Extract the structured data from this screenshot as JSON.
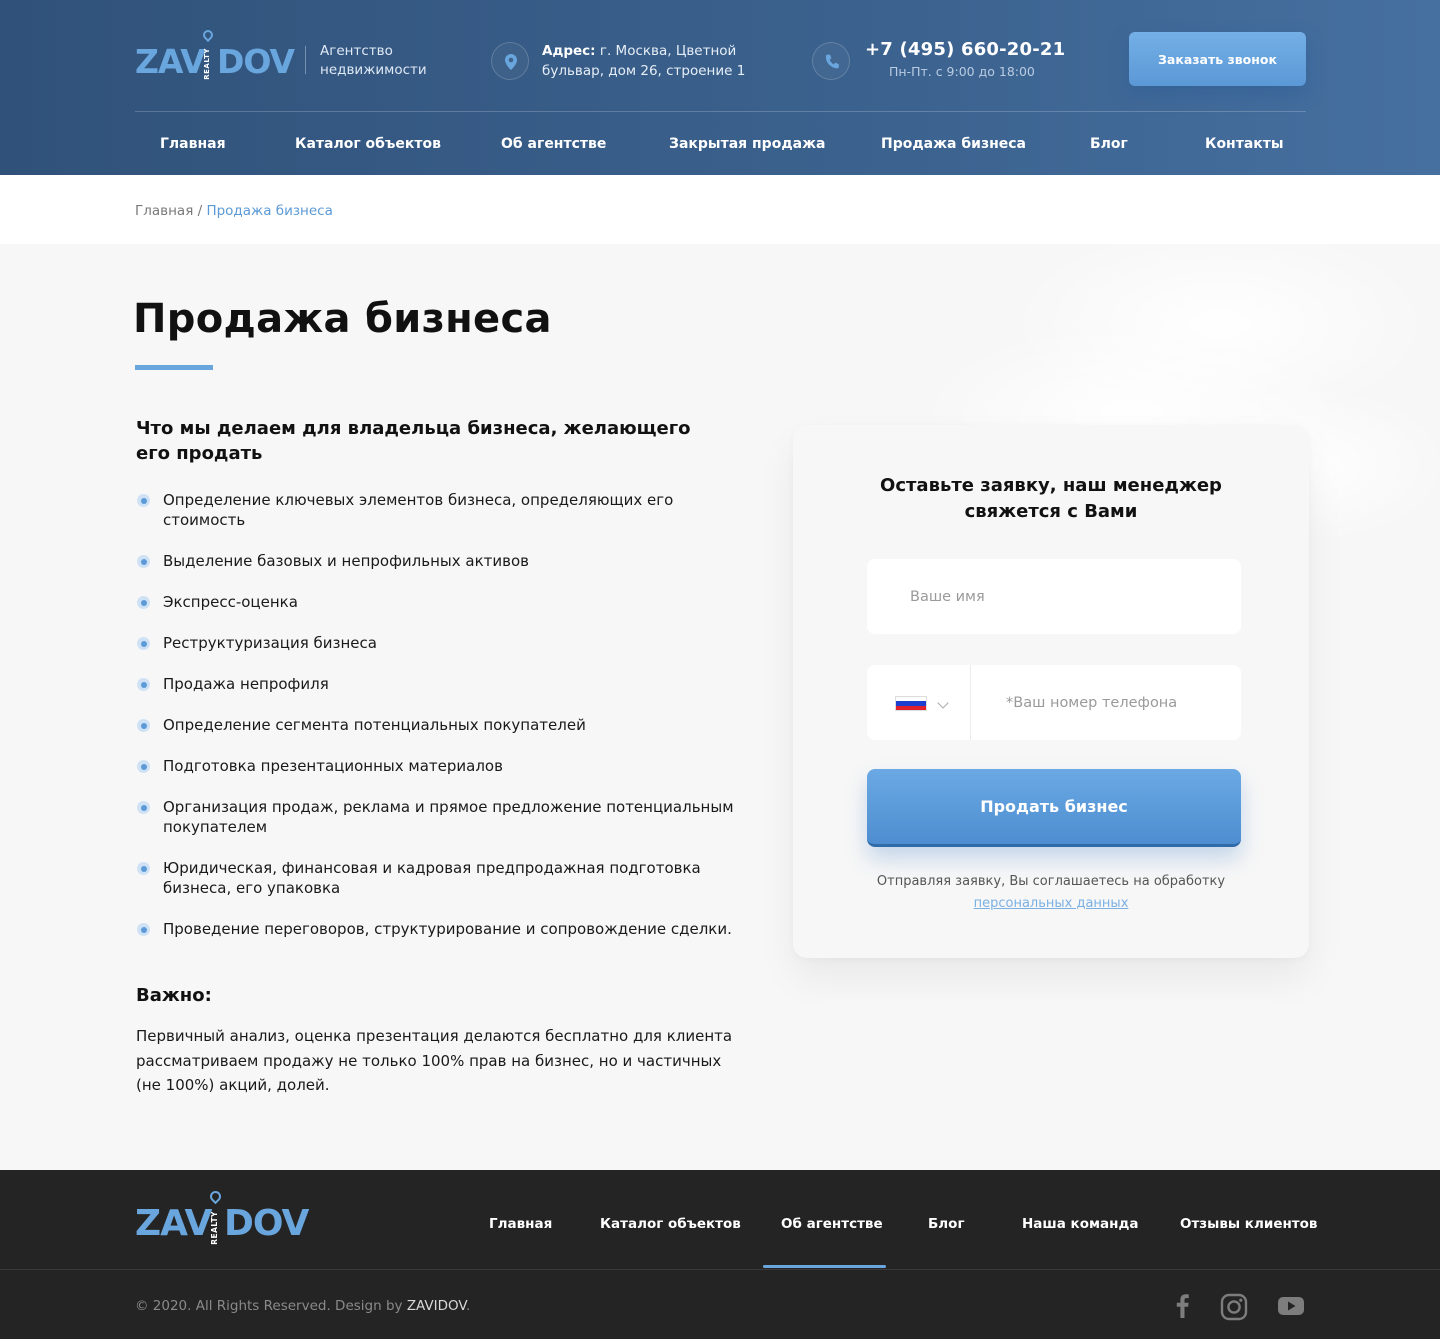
{
  "brand": {
    "logo_left": "ZAV",
    "logo_right": "DOV",
    "logo_realty": "REALTY",
    "tagline": "Агентство недвижимости"
  },
  "header": {
    "address_label": "Адрес:",
    "address_text": " г. Москва, Цветной бульвар, дом 26, строение 1",
    "phone": "+7 (495) 660-20-21",
    "hours": "Пн-Пт. с  9:00 до 18:00",
    "callback_label": "Заказать звонок",
    "nav": [
      "Главная",
      "Каталог объектов",
      "Об агентстве",
      "Закрытая продажа",
      "Продажа бизнеса",
      "Блог",
      "Контакты"
    ]
  },
  "breadcrumb": {
    "home": "Главная",
    "separator": " / ",
    "current": "Продажа бизнеса"
  },
  "main": {
    "title": "Продажа бизнеса",
    "subtitle": "Что мы делаем для владельца бизнеса, желающего его продать",
    "items": [
      "Определение ключевых элементов бизнеса, определяющих его стоимость",
      "Выделение базовых и непрофильных активов",
      "Экспресс-оценка",
      "Реструктуризация бизнеса",
      "Продажа непрофиля",
      "Определение сегмента потенциальных покупателей",
      "Подготовка презентационных материалов",
      "Организация продаж, реклама и прямое предложение потенциальным покупателем",
      "Юридическая, финансовая и кадровая предпродажная подготовка бизнеса, его упаковка",
      "Проведение переговоров, структурирование и сопровождение сделки."
    ],
    "important_title": "Важно:",
    "important_text": "Первичный анализ, оценка презентация делаются бесплатно для клиента рассматриваем продажу не только 100% прав на бизнес, но и частичных (не 100%) акций, долей."
  },
  "form": {
    "title": "Оставьте заявку, наш менеджер свяжется с Вами",
    "name_placeholder": "Ваше имя",
    "name_value": "",
    "phone_placeholder": "*Ваш номер телефона",
    "phone_value": "",
    "country": "Russia",
    "submit_label": "Продать бизнес",
    "consent_text": "Отправляя заявку, Вы соглашаетесь на обработку",
    "consent_link": "персональных данных"
  },
  "footer": {
    "nav": [
      "Главная",
      "Каталог объектов",
      "Об агентстве",
      "Блог",
      "Наша команда",
      "Отзывы клиентов"
    ],
    "active_index": 2,
    "copyright": "© 2020. All Rights Reserved. Design by ",
    "copyright_brand": "ZAVIDOV",
    "copyright_end": ".",
    "social": [
      "facebook-icon",
      "instagram-icon",
      "youtube-icon"
    ]
  },
  "colors": {
    "accent": "#6aa6de",
    "header_bg": "#30527a",
    "footer_bg": "#242424",
    "button": "#5b98d6"
  }
}
